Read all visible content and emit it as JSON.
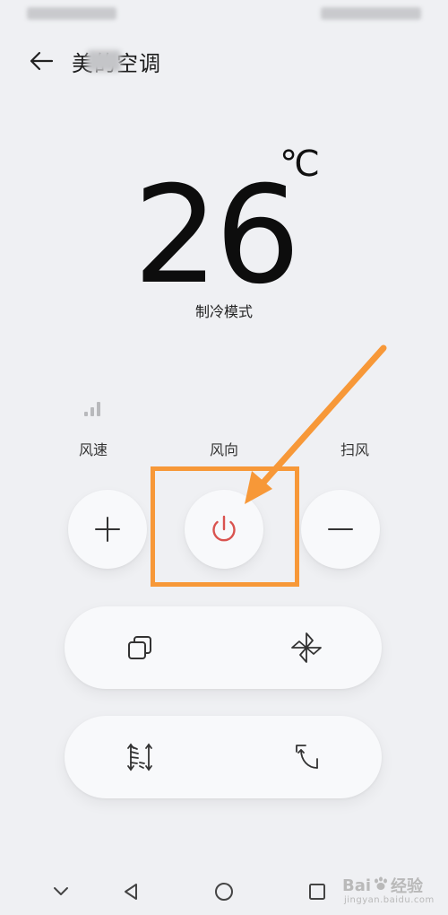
{
  "header": {
    "title": "美的空调"
  },
  "temperature": {
    "value": "26",
    "unit": "℃",
    "mode": "制冷模式"
  },
  "controls": {
    "fan_speed_label": "风速",
    "wind_direction_label": "风向",
    "sweep_label": "扫风"
  },
  "icons": {
    "back": "back-arrow-icon",
    "signal": "signal-bars-icon",
    "plus": "plus-icon",
    "power": "power-icon",
    "minus": "minus-icon",
    "windows": "overlapping-squares-icon",
    "fan": "fan-icon",
    "sweep_vertical": "vertical-sweep-icon",
    "sweep_corner": "corner-swing-icon",
    "nav_down": "chevron-down-icon",
    "nav_back": "triangle-back-icon",
    "nav_home": "circle-home-icon",
    "nav_recent": "square-recent-icon"
  },
  "colors": {
    "background": "#eff0f3",
    "button": "#f8f9fb",
    "power": "#d9534f",
    "annotation": "#f79838"
  },
  "watermark": {
    "main_left": "Bai",
    "main_right": "经验",
    "sub": "jingyan.baidu.com"
  }
}
